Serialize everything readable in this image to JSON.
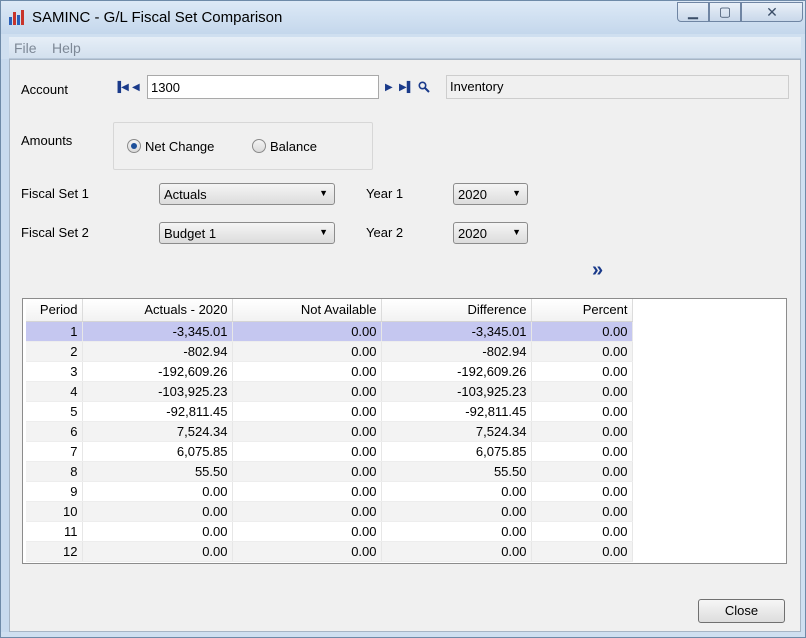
{
  "window": {
    "title": "SAMINC - G/L Fiscal Set Comparison",
    "minimize_glyph": "▁",
    "maximize_glyph": "▢",
    "close_glyph": "✕"
  },
  "menu": {
    "items": [
      "File",
      "Help"
    ]
  },
  "account": {
    "label": "Account",
    "value": "1300",
    "description": "Inventory",
    "nav_first": "▐◀",
    "nav_prev": "◀",
    "nav_next": "▶",
    "nav_last": "▶▌",
    "finder_glyph": "🔍"
  },
  "amounts": {
    "label": "Amounts",
    "options": [
      "Net Change",
      "Balance"
    ],
    "selected": "Net Change"
  },
  "fiscal_set_1": {
    "label": "Fiscal Set 1",
    "value": "Actuals"
  },
  "fiscal_set_2": {
    "label": "Fiscal Set 2",
    "value": "Budget 1"
  },
  "year_1": {
    "label": "Year 1",
    "value": "2020"
  },
  "year_2": {
    "label": "Year 2",
    "value": "2020"
  },
  "go_glyph": "»",
  "grid": {
    "columns": [
      "Period",
      "Actuals - 2020",
      "Not Available",
      "Difference",
      "Percent"
    ],
    "rows": [
      [
        "1",
        "-3,345.01",
        "0.00",
        "-3,345.01",
        "0.00"
      ],
      [
        "2",
        "-802.94",
        "0.00",
        "-802.94",
        "0.00"
      ],
      [
        "3",
        "-192,609.26",
        "0.00",
        "-192,609.26",
        "0.00"
      ],
      [
        "4",
        "-103,925.23",
        "0.00",
        "-103,925.23",
        "0.00"
      ],
      [
        "5",
        "-92,811.45",
        "0.00",
        "-92,811.45",
        "0.00"
      ],
      [
        "6",
        "7,524.34",
        "0.00",
        "7,524.34",
        "0.00"
      ],
      [
        "7",
        "6,075.85",
        "0.00",
        "6,075.85",
        "0.00"
      ],
      [
        "8",
        "55.50",
        "0.00",
        "55.50",
        "0.00"
      ],
      [
        "9",
        "0.00",
        "0.00",
        "0.00",
        "0.00"
      ],
      [
        "10",
        "0.00",
        "0.00",
        "0.00",
        "0.00"
      ],
      [
        "11",
        "0.00",
        "0.00",
        "0.00",
        "0.00"
      ],
      [
        "12",
        "0.00",
        "0.00",
        "0.00",
        "0.00"
      ]
    ],
    "selected_row": 0
  },
  "close_button": "Close",
  "colors": {
    "selection": "#c5c7f0",
    "nav_icon": "#1a3a8a",
    "frame": "#cfdff0"
  }
}
